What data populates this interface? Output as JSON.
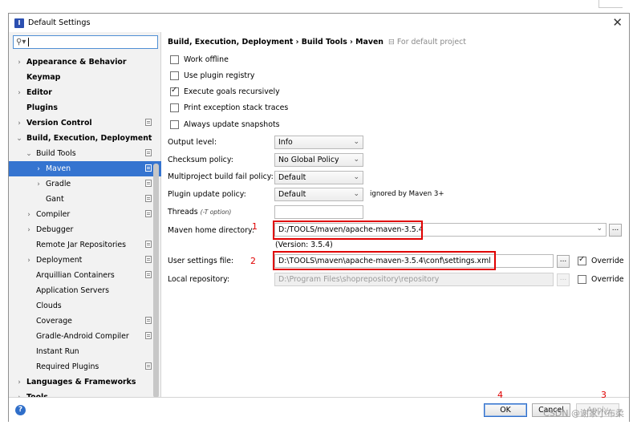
{
  "window": {
    "title": "Default Settings",
    "close": "✕"
  },
  "search": {
    "value": "",
    "icon": "search-icon"
  },
  "tree": [
    {
      "label": "Appearance & Behavior",
      "indent": 0,
      "arrow": "›",
      "bold": true,
      "page": false
    },
    {
      "label": "Keymap",
      "indent": 0,
      "arrow": "",
      "bold": true,
      "page": false
    },
    {
      "label": "Editor",
      "indent": 0,
      "arrow": "›",
      "bold": true,
      "page": false
    },
    {
      "label": "Plugins",
      "indent": 0,
      "arrow": "",
      "bold": true,
      "page": false
    },
    {
      "label": "Version Control",
      "indent": 0,
      "arrow": "›",
      "bold": true,
      "page": true
    },
    {
      "label": "Build, Execution, Deployment",
      "indent": 0,
      "arrow": "⌄",
      "bold": true,
      "page": false
    },
    {
      "label": "Build Tools",
      "indent": 1,
      "arrow": "⌄",
      "bold": false,
      "page": true
    },
    {
      "label": "Maven",
      "indent": 2,
      "arrow": "›",
      "bold": false,
      "page": true,
      "selected": true
    },
    {
      "label": "Gradle",
      "indent": 2,
      "arrow": "›",
      "bold": false,
      "page": true
    },
    {
      "label": "Gant",
      "indent": 2,
      "arrow": "",
      "bold": false,
      "page": true
    },
    {
      "label": "Compiler",
      "indent": 1,
      "arrow": "›",
      "bold": false,
      "page": true
    },
    {
      "label": "Debugger",
      "indent": 1,
      "arrow": "›",
      "bold": false,
      "page": false
    },
    {
      "label": "Remote Jar Repositories",
      "indent": 1,
      "arrow": "",
      "bold": false,
      "page": true
    },
    {
      "label": "Deployment",
      "indent": 1,
      "arrow": "›",
      "bold": false,
      "page": true
    },
    {
      "label": "Arquillian Containers",
      "indent": 1,
      "arrow": "",
      "bold": false,
      "page": true
    },
    {
      "label": "Application Servers",
      "indent": 1,
      "arrow": "",
      "bold": false,
      "page": false
    },
    {
      "label": "Clouds",
      "indent": 1,
      "arrow": "",
      "bold": false,
      "page": false
    },
    {
      "label": "Coverage",
      "indent": 1,
      "arrow": "",
      "bold": false,
      "page": true
    },
    {
      "label": "Gradle-Android Compiler",
      "indent": 1,
      "arrow": "",
      "bold": false,
      "page": true
    },
    {
      "label": "Instant Run",
      "indent": 1,
      "arrow": "",
      "bold": false,
      "page": false
    },
    {
      "label": "Required Plugins",
      "indent": 1,
      "arrow": "",
      "bold": false,
      "page": true
    },
    {
      "label": "Languages & Frameworks",
      "indent": 0,
      "arrow": "›",
      "bold": true,
      "page": false
    },
    {
      "label": "Tools",
      "indent": 0,
      "arrow": "›",
      "bold": true,
      "page": false
    }
  ],
  "crumb": {
    "path": "Build, Execution, Deployment › Build Tools › Maven",
    "note": "⊟ For default project"
  },
  "checks": {
    "offline": {
      "label": "Work offline",
      "checked": false
    },
    "plugin_registry": {
      "label": "Use plugin registry",
      "checked": false
    },
    "recursive": {
      "label": "Execute goals recursively",
      "checked": true
    },
    "stack_traces": {
      "label": "Print exception stack traces",
      "checked": false
    },
    "snapshots": {
      "label": "Always update snapshots",
      "checked": false
    }
  },
  "fields": {
    "output_level": {
      "label": "Output level:",
      "value": "Info"
    },
    "checksum": {
      "label": "Checksum policy:",
      "value": "No Global Policy"
    },
    "multiproject": {
      "label": "Multiproject build fail policy:",
      "value": "Default"
    },
    "plugin_update": {
      "label": "Plugin update policy:",
      "value": "Default",
      "note": "ignored by Maven 3+"
    },
    "threads": {
      "label": "Threads",
      "hint": "(-T option)",
      "value": ""
    },
    "maven_home": {
      "label": "Maven home directory:",
      "value": "D:/TOOLS/maven/apache-maven-3.5.4",
      "version": "(Version: 3.5.4)",
      "browse": "..."
    },
    "settings_file": {
      "label": "User settings file:",
      "value": "D:\\TOOLS\\maven\\apache-maven-3.5.4\\conf\\settings.xml",
      "browse": "...",
      "override": "Override",
      "override_checked": true
    },
    "local_repo": {
      "label": "Local repository:",
      "value": "D:\\Program Files\\shoprepository\\repository",
      "browse": "...",
      "override": "Override",
      "override_checked": false
    }
  },
  "annotations": {
    "a1": "1",
    "a2": "2",
    "a3": "3",
    "a4": "4"
  },
  "footer": {
    "help": "?",
    "ok": "OK",
    "cancel": "Cancel",
    "apply": "Apply"
  },
  "watermark": "CSDN @谢家小布柔"
}
